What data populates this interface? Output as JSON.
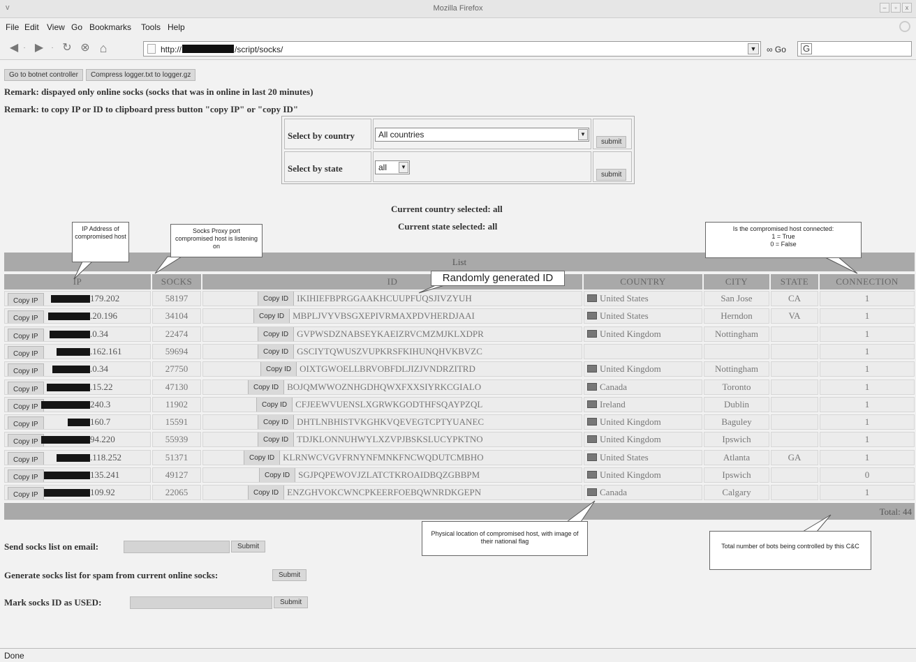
{
  "window": {
    "title": "Mozilla Firefox"
  },
  "menu": {
    "items": [
      "File",
      "Edit",
      "View",
      "Go",
      "Bookmarks",
      "Tools",
      "Help"
    ]
  },
  "navbar": {
    "url_prefix": "http://",
    "url_suffix": "/script/socks/",
    "go_label": "Go",
    "icons": [
      "back-icon",
      "forward-icon",
      "reload-icon",
      "stop-icon",
      "home-icon"
    ]
  },
  "buttons": {
    "goto_controller": "Go to botnet controller",
    "compress_logger": "Compress logger.txt to logger.gz"
  },
  "remarks": [
    "Remark: dispayed only online socks (socks that was in online in last 20 minutes)",
    "Remark: to copy IP or ID to clipboard press button \"copy IP\" or \"copy ID\""
  ],
  "filter": {
    "country_label": "Select by country",
    "country_value": "All countries",
    "state_label": "Select by state",
    "state_value": "all",
    "submit_label": "submit"
  },
  "current": {
    "country": "Current country selected: all",
    "state": "Current state selected: all"
  },
  "callouts": {
    "ip": "IP Address of compromised host",
    "socks": "Socks Proxy port compromised host is listening on",
    "connection_line1": "Is the compromised host connected:",
    "connection_line2": "1 = True",
    "connection_line3": "0 = False",
    "id": "Randomly generated ID",
    "location": "Physical location of compromised host, with image of their national flag",
    "total": "Total number of bots being controlled by this C&C"
  },
  "table": {
    "title": "List",
    "headers": [
      "IP",
      "SOCKS",
      "ID",
      "COUNTRY",
      "CITY",
      "STATE",
      "CONNECTION"
    ],
    "copy_ip_label": "Copy IP",
    "copy_id_label": "Copy ID",
    "rows": [
      {
        "ip": "179.202",
        "socks": "58197",
        "id": "IKIHIEFBPRGGAAKHCUUPFUQSJIVZYUH",
        "country": "United States",
        "city": "San Jose",
        "state": "CA",
        "connection": "1"
      },
      {
        "ip": ".20.196",
        "socks": "34104",
        "id": "MBPLJVYVBSGXEPIVRMAXPDVHERDJAAI",
        "country": "United States",
        "city": "Herndon",
        "state": "VA",
        "connection": "1"
      },
      {
        "ip": ".0.34",
        "socks": "22474",
        "id": "GVPWSDZNABSEYKAEIZRVCMZMJKLXDPR",
        "country": "United Kingdom",
        "city": "Nottingham",
        "state": "",
        "connection": "1"
      },
      {
        "ip": ".162.161",
        "socks": "59694",
        "id": "GSCIYTQWUSZVUPKRSFKIHUNQHVKBVZC",
        "country": "",
        "city": "",
        "state": "",
        "connection": "1"
      },
      {
        "ip": ".0.34",
        "socks": "27750",
        "id": "OIXTGWOELLBRVOBFDLJIZJVNDRZITRD",
        "country": "United Kingdom",
        "city": "Nottingham",
        "state": "",
        "connection": "1"
      },
      {
        "ip": ".15.22",
        "socks": "47130",
        "id": "BOJQMWWOZNHGDHQWXFXXSIYRKCGIALO",
        "country": "Canada",
        "city": "Toronto",
        "state": "",
        "connection": "1"
      },
      {
        "ip": "240.3",
        "socks": "11902",
        "id": "CFJEEWVUENSLXGRWKGODTHFSQAYPZQL",
        "country": "Ireland",
        "city": "Dublin",
        "state": "",
        "connection": "1"
      },
      {
        "ip": "160.7",
        "socks": "15591",
        "id": "DHTLNBHISTVKGHKVQEVEGTCPTYUANEC",
        "country": "United Kingdom",
        "city": "Baguley",
        "state": "",
        "connection": "1"
      },
      {
        "ip": "94.220",
        "socks": "55939",
        "id": "TDJKLONNUHWYLXZVPJBSKSLUCYPKTNO",
        "country": "United Kingdom",
        "city": "Ipswich",
        "state": "",
        "connection": "1"
      },
      {
        "ip": ".118.252",
        "socks": "51371",
        "id": "KLRNWCVGVFRNYNFMNKFNCWQDUTCMBHO",
        "country": "United States",
        "city": "Atlanta",
        "state": "GA",
        "connection": "1"
      },
      {
        "ip": "135.241",
        "socks": "49127",
        "id": "SGJPQPEWOVJZLATCTKROAIDBQZGBBPM",
        "country": "United Kingdom",
        "city": "Ipswich",
        "state": "",
        "connection": "0"
      },
      {
        "ip": "109.92",
        "socks": "22065",
        "id": "ENZGHVOKCWNCPKEERFOEBQWNRDKGEPN",
        "country": "Canada",
        "city": "Calgary",
        "state": "",
        "connection": "1"
      }
    ],
    "total": "Total: 44"
  },
  "forms": {
    "email_label": "Send socks list on email:",
    "spam_label": "Generate socks list for spam from current online socks:",
    "mark_label": "Mark socks ID as USED:",
    "submit_label": "Submit"
  },
  "status": {
    "text": "Done"
  }
}
